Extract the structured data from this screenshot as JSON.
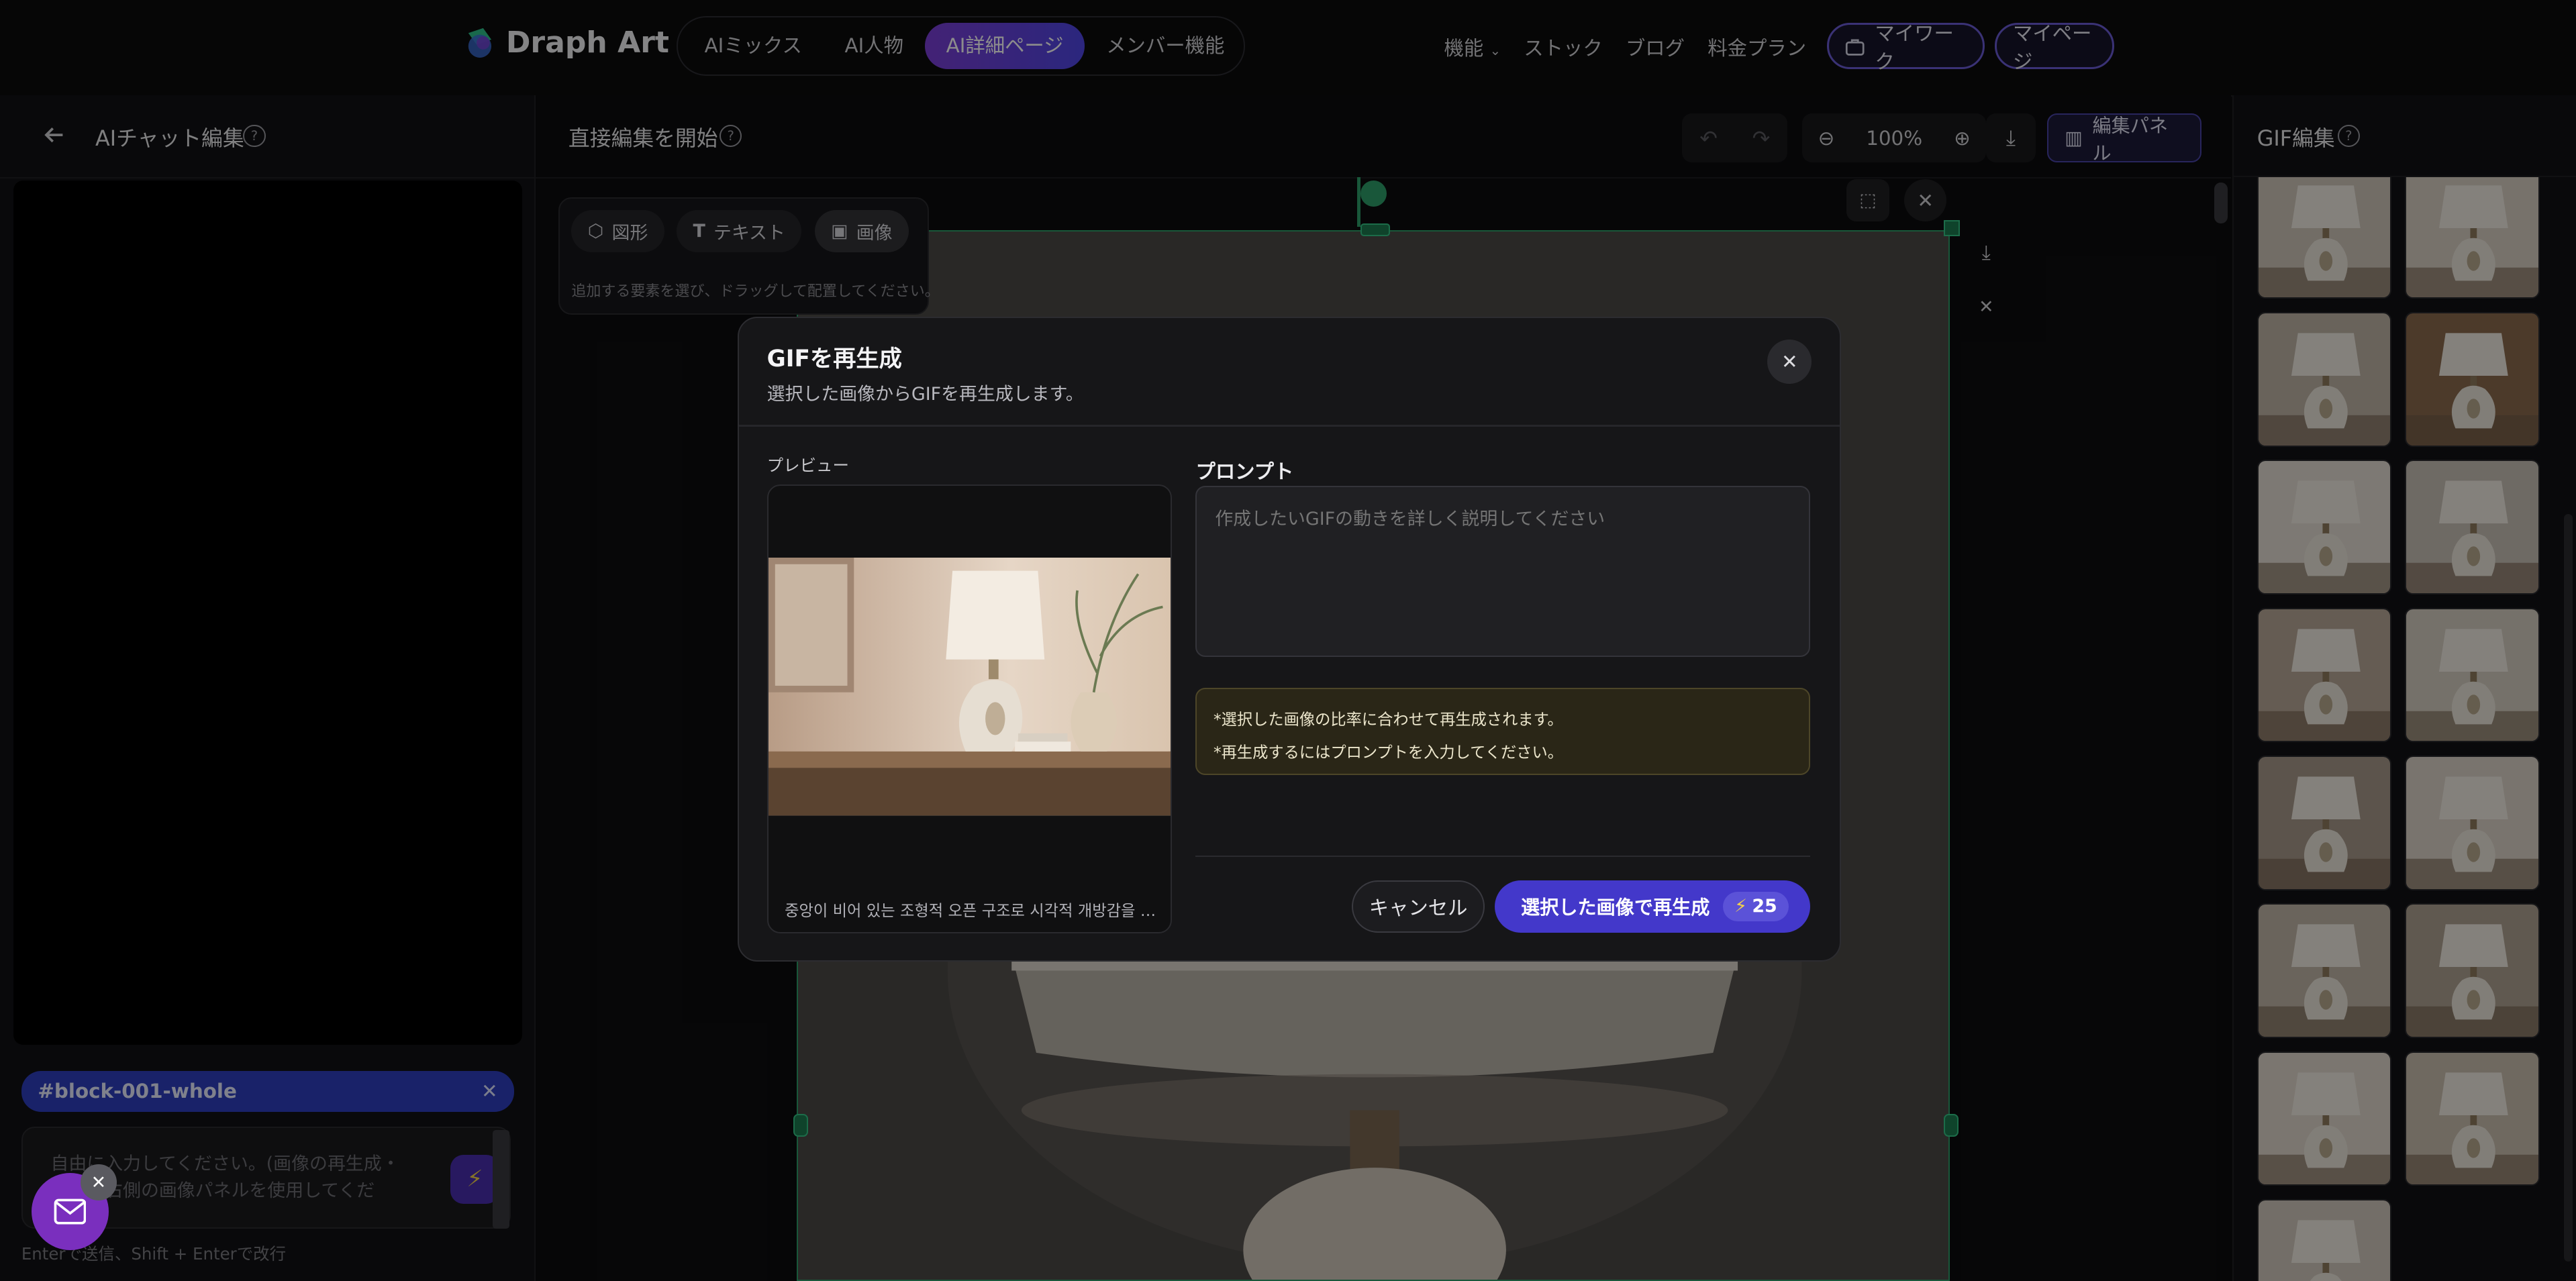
{
  "brand": {
    "name": "Draph Art",
    "accent": "#4f46e5"
  },
  "nav": {
    "tabs": [
      {
        "label": "AIミックス"
      },
      {
        "label": "AI人物"
      },
      {
        "label": "AI詳細ページ",
        "active": true
      },
      {
        "label": "メンバー機能"
      }
    ],
    "links": [
      {
        "label": "機能"
      },
      {
        "label": "ストック"
      },
      {
        "label": "ブログ"
      },
      {
        "label": "料金プラン"
      }
    ],
    "mywork": "マイワーク",
    "mypage": "マイページ"
  },
  "left": {
    "title": "AIチャット編集",
    "tag": "#block-001-whole",
    "chat_placeholder": "自由に入力してください。(画像の再生成・置換は右側の画像パネルを使用してくだ",
    "hint": "Enterで送信、Shift + Enterで改行"
  },
  "center": {
    "title": "直接編集を開始",
    "zoom": "100%",
    "edit_panel": "編集パネル",
    "tools": [
      {
        "label": "図形"
      },
      {
        "label": "テキスト"
      },
      {
        "label": "画像"
      }
    ],
    "tool_hint": "追加する要素を選び、ドラッグして配置してください。"
  },
  "right": {
    "title": "GIF編集",
    "thumb_count": 15
  },
  "modal": {
    "title": "GIFを再生成",
    "subtitle": "選択した画像からGIFを再生成します。",
    "preview_label": "プレビュー",
    "preview_caption": "중앙이 비어 있는 조형적 오픈 구조로 시각적 개방감을 주...",
    "prompt_label": "プロンプト",
    "prompt_placeholder": "作成したいGIFの動きを詳しく説明してください",
    "notes": [
      "*選択した画像の比率に合わせて再生成されます。",
      "*再生成するにはプロンプトを入力してください。"
    ],
    "cancel": "キャンセル",
    "regenerate": "選択した画像で再生成",
    "cost": "25"
  }
}
